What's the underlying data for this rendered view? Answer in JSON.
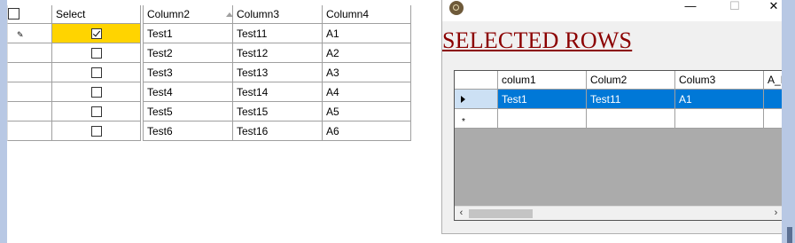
{
  "main_grid": {
    "columns": [
      "Select",
      "Column2",
      "Column3",
      "Column4"
    ],
    "rows": [
      {
        "checked": true,
        "c2": "Test1",
        "c3": "Test11",
        "c4": "A1"
      },
      {
        "checked": false,
        "c2": "Test2",
        "c3": "Test12",
        "c4": "A2"
      },
      {
        "checked": false,
        "c2": "Test3",
        "c3": "Test13",
        "c4": "A3"
      },
      {
        "checked": false,
        "c2": "Test4",
        "c3": "Test14",
        "c4": "A4"
      },
      {
        "checked": false,
        "c2": "Test5",
        "c3": "Test15",
        "c4": "A5"
      },
      {
        "checked": false,
        "c2": "Test6",
        "c3": "Test16",
        "c4": "A6"
      }
    ],
    "highlight_color": "#ffd400"
  },
  "popup": {
    "heading": "SELECTED ROWS",
    "heading_color": "#8b0000",
    "controls": {
      "minimize": "—",
      "maximize": "☐",
      "close": "✕"
    },
    "grid": {
      "columns": [
        "colum1",
        "Colum2",
        "Colum3",
        "A_I"
      ],
      "rows": [
        {
          "c1": "Test1",
          "c2": "Test11",
          "c3": "A1",
          "c4": ""
        }
      ],
      "selected_color": "#0078d7"
    },
    "scroll": {
      "left": "‹",
      "right": "›"
    }
  }
}
